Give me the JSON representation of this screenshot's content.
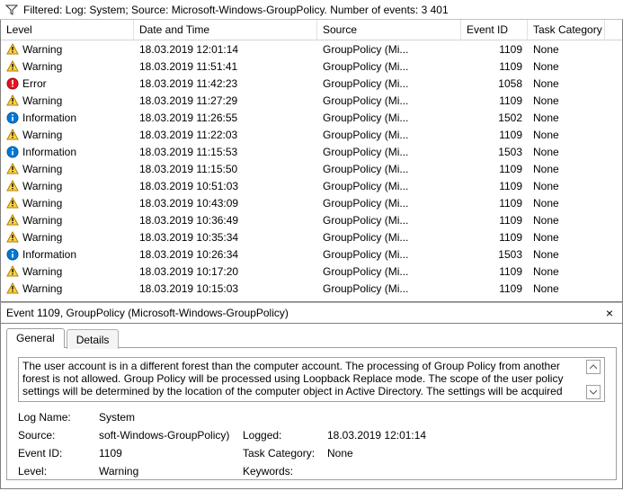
{
  "filter": {
    "text": "Filtered: Log: System; Source: Microsoft-Windows-GroupPolicy. Number of events: 3 401"
  },
  "table": {
    "headers": {
      "level": "Level",
      "date": "Date and Time",
      "source": "Source",
      "event_id": "Event ID",
      "task_category": "Task Category"
    },
    "rows": [
      {
        "icon": "warning",
        "level": "Warning",
        "date": "18.03.2019 12:01:14",
        "source": "GroupPolicy (Mi...",
        "eid": "1109",
        "cat": "None"
      },
      {
        "icon": "warning",
        "level": "Warning",
        "date": "18.03.2019 11:51:41",
        "source": "GroupPolicy (Mi...",
        "eid": "1109",
        "cat": "None"
      },
      {
        "icon": "error",
        "level": "Error",
        "date": "18.03.2019 11:42:23",
        "source": "GroupPolicy (Mi...",
        "eid": "1058",
        "cat": "None"
      },
      {
        "icon": "warning",
        "level": "Warning",
        "date": "18.03.2019 11:27:29",
        "source": "GroupPolicy (Mi...",
        "eid": "1109",
        "cat": "None"
      },
      {
        "icon": "info",
        "level": "Information",
        "date": "18.03.2019 11:26:55",
        "source": "GroupPolicy (Mi...",
        "eid": "1502",
        "cat": "None"
      },
      {
        "icon": "warning",
        "level": "Warning",
        "date": "18.03.2019 11:22:03",
        "source": "GroupPolicy (Mi...",
        "eid": "1109",
        "cat": "None"
      },
      {
        "icon": "info",
        "level": "Information",
        "date": "18.03.2019 11:15:53",
        "source": "GroupPolicy (Mi...",
        "eid": "1503",
        "cat": "None"
      },
      {
        "icon": "warning",
        "level": "Warning",
        "date": "18.03.2019 11:15:50",
        "source": "GroupPolicy (Mi...",
        "eid": "1109",
        "cat": "None"
      },
      {
        "icon": "warning",
        "level": "Warning",
        "date": "18.03.2019 10:51:03",
        "source": "GroupPolicy (Mi...",
        "eid": "1109",
        "cat": "None"
      },
      {
        "icon": "warning",
        "level": "Warning",
        "date": "18.03.2019 10:43:09",
        "source": "GroupPolicy (Mi...",
        "eid": "1109",
        "cat": "None"
      },
      {
        "icon": "warning",
        "level": "Warning",
        "date": "18.03.2019 10:36:49",
        "source": "GroupPolicy (Mi...",
        "eid": "1109",
        "cat": "None"
      },
      {
        "icon": "warning",
        "level": "Warning",
        "date": "18.03.2019 10:35:34",
        "source": "GroupPolicy (Mi...",
        "eid": "1109",
        "cat": "None"
      },
      {
        "icon": "info",
        "level": "Information",
        "date": "18.03.2019 10:26:34",
        "source": "GroupPolicy (Mi...",
        "eid": "1503",
        "cat": "None"
      },
      {
        "icon": "warning",
        "level": "Warning",
        "date": "18.03.2019 10:17:20",
        "source": "GroupPolicy (Mi...",
        "eid": "1109",
        "cat": "None"
      },
      {
        "icon": "warning",
        "level": "Warning",
        "date": "18.03.2019 10:15:03",
        "source": "GroupPolicy (Mi...",
        "eid": "1109",
        "cat": "None"
      }
    ]
  },
  "detail": {
    "header": "Event 1109, GroupPolicy (Microsoft-Windows-GroupPolicy)",
    "tabs": {
      "general": "General",
      "details": "Details"
    },
    "description": "The user account is in a different forest than the computer account. The processing of Group Policy from another forest is not allowed. Group Policy will be processed using Loopback Replace mode. The scope of the user policy settings will be determined by the location of the computer object in Active Directory. The settings will be acquired",
    "props": {
      "log_name_lbl": "Log Name:",
      "log_name_val": "System",
      "source_lbl": "Source:",
      "source_val": "soft-Windows-GroupPolicy)",
      "logged_lbl": "Logged:",
      "logged_val": "18.03.2019 12:01:14",
      "event_id_lbl": "Event ID:",
      "event_id_val": "1109",
      "task_cat_lbl": "Task Category:",
      "task_cat_val": "None",
      "level_lbl": "Level:",
      "level_val": "Warning",
      "keywords_lbl": "Keywords:",
      "keywords_val": ""
    }
  }
}
